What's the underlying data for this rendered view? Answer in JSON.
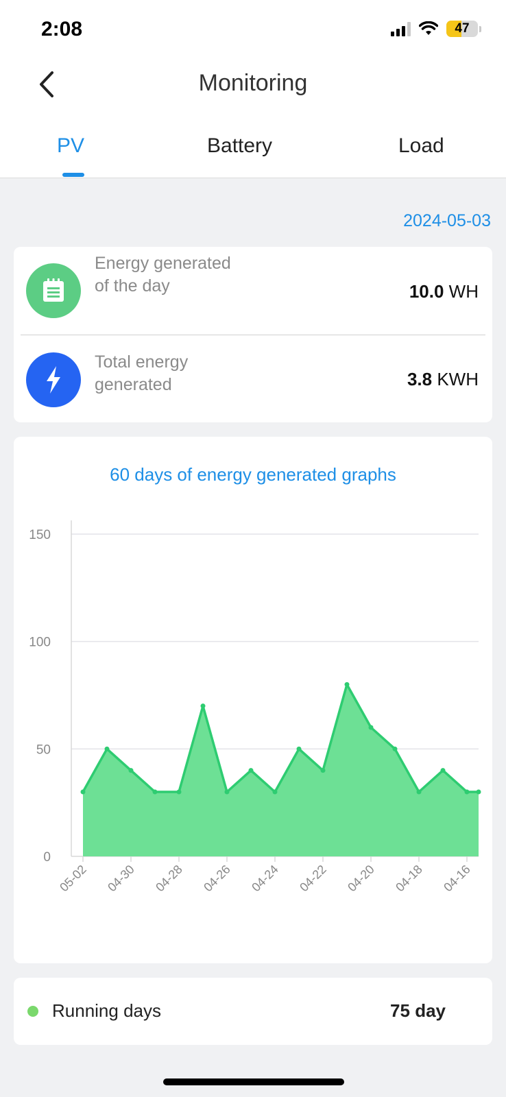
{
  "status_bar": {
    "time": "2:08",
    "battery": "47",
    "battery_level": 0.47
  },
  "header": {
    "title": "Monitoring"
  },
  "tabs": [
    {
      "label": "PV",
      "active": true
    },
    {
      "label": "Battery",
      "active": false
    },
    {
      "label": "Load",
      "active": false
    }
  ],
  "date": "2024-05-03",
  "energy": {
    "daily": {
      "label": "Energy generated of the day",
      "value": "10.0",
      "unit": "WH"
    },
    "total": {
      "label": "Total energy generated",
      "value": "3.8",
      "unit": "KWH"
    }
  },
  "chart_data": {
    "type": "area",
    "title": "60 days of energy generated graphs",
    "x_tick_labels": [
      "05-02",
      "04-30",
      "04-28",
      "04-26",
      "04-24",
      "04-22",
      "04-20",
      "04-18",
      "04-16"
    ],
    "x": [
      "05-02",
      "05-01",
      "04-30",
      "04-29",
      "04-28",
      "04-27",
      "04-26",
      "04-25",
      "04-24",
      "04-23",
      "04-22",
      "04-21",
      "04-20",
      "04-19",
      "04-18",
      "04-17",
      "04-16",
      "04-15"
    ],
    "values": [
      30,
      50,
      40,
      30,
      30,
      70,
      30,
      40,
      30,
      50,
      40,
      80,
      60,
      50,
      30,
      40,
      30,
      30
    ],
    "ylim": [
      0,
      150
    ],
    "y_ticks": [
      0,
      50,
      100,
      150
    ],
    "grid": true,
    "color": "#6de095",
    "line_color": "#2ecc71"
  },
  "running": {
    "label": "Running days",
    "value": "75 day",
    "dot_color": "#7ad86c"
  },
  "colors": {
    "accent": "#1e8fe6",
    "green_icon": "#5ccd84",
    "blue_icon": "#2564f2"
  }
}
